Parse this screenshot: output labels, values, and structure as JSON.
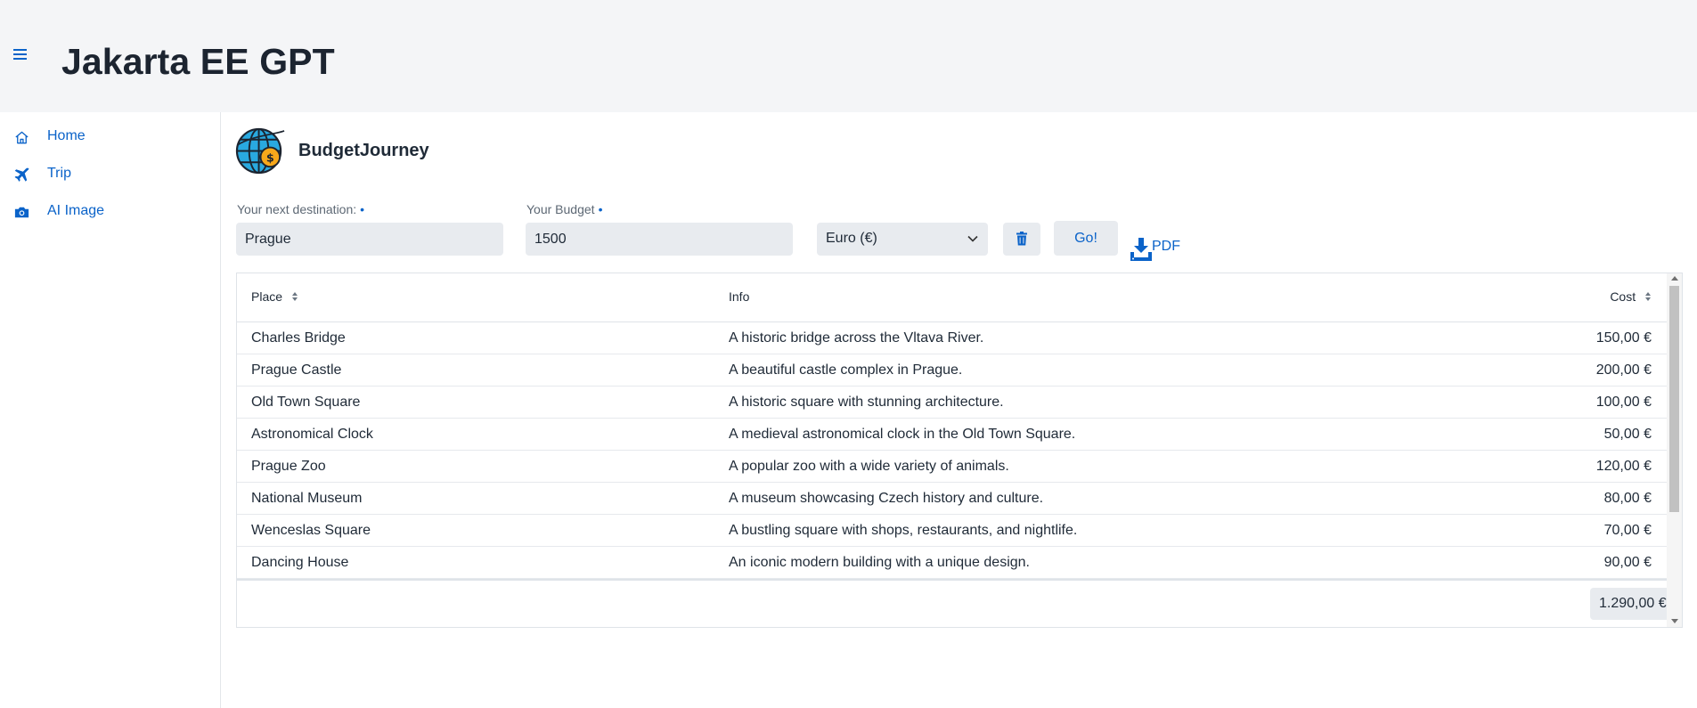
{
  "app": {
    "title": "Jakarta EE GPT"
  },
  "sidebar": {
    "items": [
      {
        "label": "Home",
        "icon": "home-icon"
      },
      {
        "label": "Trip",
        "icon": "plane-icon"
      },
      {
        "label": "AI Image",
        "icon": "camera-icon"
      }
    ]
  },
  "page": {
    "brand": "BudgetJourney",
    "logo_icon": "globe-money-icon"
  },
  "form": {
    "destination_label": "Your next destination:",
    "destination_value": "Prague",
    "budget_label": "Your Budget",
    "budget_value": "1500",
    "required_marker": "•",
    "currency_selected": "Euro (€)",
    "go_label": "Go!",
    "pdf_label": "PDF"
  },
  "table": {
    "columns": [
      "Place",
      "Info",
      "Cost"
    ],
    "rows": [
      {
        "place": "Charles Bridge",
        "info": "A historic bridge across the Vltava River.",
        "cost": "150,00 €"
      },
      {
        "place": "Prague Castle",
        "info": "A beautiful castle complex in Prague.",
        "cost": "200,00 €"
      },
      {
        "place": "Old Town Square",
        "info": "A historic square with stunning architecture.",
        "cost": "100,00 €"
      },
      {
        "place": "Astronomical Clock",
        "info": "A medieval astronomical clock in the Old Town Square.",
        "cost": "50,00 €"
      },
      {
        "place": "Prague Zoo",
        "info": "A popular zoo with a wide variety of animals.",
        "cost": "120,00 €"
      },
      {
        "place": "National Museum",
        "info": "A museum showcasing Czech history and culture.",
        "cost": "80,00 €"
      },
      {
        "place": "Wenceslas Square",
        "info": "A bustling square with shops, restaurants, and nightlife.",
        "cost": "70,00 €"
      },
      {
        "place": "Dancing House",
        "info": "An iconic modern building with a unique design.",
        "cost": "90,00 €"
      }
    ],
    "total": "1.290,00 €"
  },
  "colors": {
    "accent": "#0b63c9",
    "header_bg": "#f4f5f7",
    "input_bg": "#e8ebef",
    "border": "#dfe3e8"
  }
}
